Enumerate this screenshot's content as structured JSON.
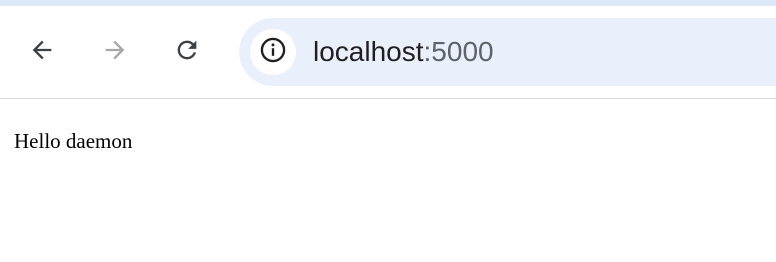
{
  "browser": {
    "address_bar": {
      "host": "localhost",
      "port_suffix": ":5000"
    },
    "icons": {
      "back": "arrow-left-icon",
      "forward": "arrow-right-icon",
      "reload": "reload-icon",
      "site_info": "info-icon"
    },
    "colors": {
      "accent_strip": "#dde8f8",
      "omnibox_bg": "#eaf0fb",
      "icon_active": "#3c4043",
      "icon_disabled": "#a7a7a7"
    }
  },
  "page": {
    "text": "Hello daemon"
  }
}
